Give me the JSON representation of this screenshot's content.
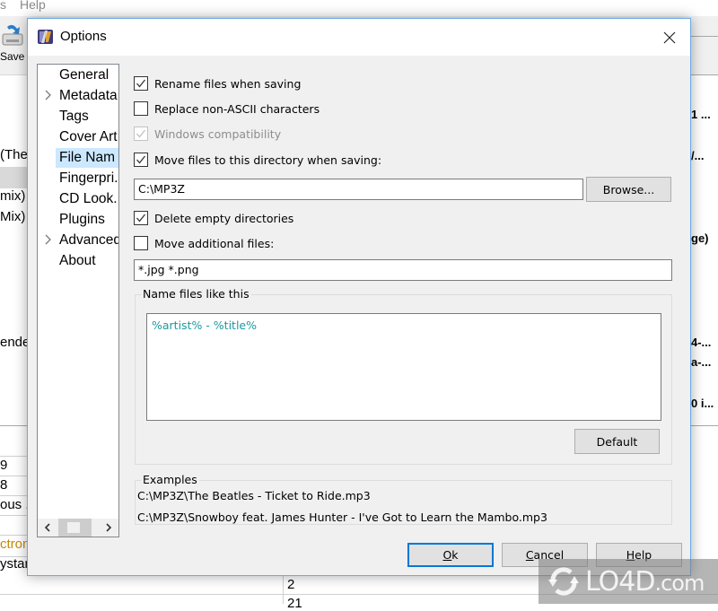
{
  "background_app": {
    "menu": [
      "s",
      "Help"
    ],
    "toolbar": {
      "save_label": "Save",
      "save_icon": "save-icon"
    },
    "left_column_fragments": [
      "(The",
      "mix)",
      "Mix)",
      "ende"
    ],
    "right_column_fragments": [
      "1 ...",
      "/...",
      "ge)",
      "4-...",
      "a-...",
      "0 i...",
      "a-"
    ],
    "lower_left_fragments": [
      "9",
      "8",
      "ous .",
      "",
      "ctron",
      "ystar"
    ],
    "lower_left_accent_color": "#c88a00",
    "lower_mid_fragments": [
      "2",
      "21"
    ]
  },
  "dialog": {
    "title": "Options",
    "title_icon": "options-app-icon",
    "close_icon": "close-icon",
    "nav": {
      "items": [
        {
          "label": "General",
          "expandable": false,
          "selected": false
        },
        {
          "label": "Metadata",
          "expandable": true,
          "selected": false
        },
        {
          "label": "Tags",
          "expandable": false,
          "selected": false
        },
        {
          "label": "Cover Art",
          "expandable": false,
          "selected": false
        },
        {
          "label": "File Nam",
          "expandable": false,
          "selected": true
        },
        {
          "label": "Fingerpri.",
          "expandable": false,
          "selected": false
        },
        {
          "label": "CD Look.",
          "expandable": false,
          "selected": false
        },
        {
          "label": "Plugins",
          "expandable": false,
          "selected": false
        },
        {
          "label": "Advanced",
          "expandable": true,
          "selected": false
        },
        {
          "label": "About",
          "expandable": false,
          "selected": false
        }
      ]
    },
    "options": {
      "rename_files": {
        "label": "Rename files when saving",
        "checked": true,
        "disabled": false
      },
      "replace_non_ascii": {
        "label": "Replace non-ASCII characters",
        "checked": false,
        "disabled": false
      },
      "windows_compat": {
        "label": "Windows compatibility",
        "checked": true,
        "disabled": true
      },
      "move_files": {
        "label": "Move files to this directory when saving:",
        "checked": true,
        "disabled": false
      },
      "directory_value": "C:\\MP3Z",
      "browse_label": "Browse...",
      "delete_empty": {
        "label": "Delete empty directories",
        "checked": true,
        "disabled": false
      },
      "move_additional": {
        "label": "Move additional files:",
        "checked": false,
        "disabled": false
      },
      "additional_files_value": "*.jpg *.png"
    },
    "naming": {
      "group_title": "Name files like this",
      "pattern": "%artist% - %title%",
      "pattern_color": "#1a9aa0",
      "default_label": "Default"
    },
    "examples": {
      "group_title": "Examples",
      "lines": [
        "C:\\MP3Z\\The Beatles - Ticket to Ride.mp3",
        "C:\\MP3Z\\Snowboy feat. James Hunter - I've Got to Learn the Mambo.mp3"
      ]
    },
    "buttons": {
      "ok": {
        "mnemonic": "O",
        "rest": "k"
      },
      "cancel": {
        "mnemonic": "C",
        "rest": "ancel"
      },
      "help": {
        "mnemonic": "H",
        "rest": "elp"
      }
    }
  },
  "watermark": {
    "text": "LO4D",
    "suffix": ".com"
  }
}
